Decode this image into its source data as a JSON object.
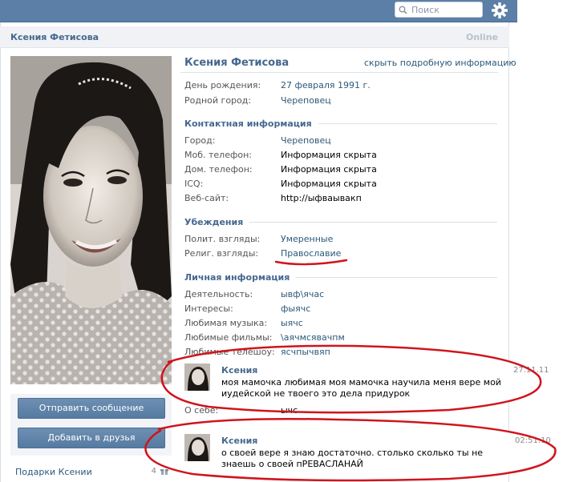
{
  "header": {
    "search_placeholder": "Поиск",
    "bar_color": "#5b7fa6"
  },
  "page": {
    "title": "Ксения Фетисова",
    "status": "Online"
  },
  "buttons": {
    "send_message": "Отправить сообщение",
    "add_friend": "Добавить в друзья"
  },
  "gifts": {
    "label": "Подарки Ксении",
    "count": "4"
  },
  "profile": {
    "name": "Ксения Фетисова",
    "hide_link": "скрыть подробную информацию",
    "basic": [
      {
        "label": "День рождения:",
        "value": "27 февраля 1991 г."
      },
      {
        "label": "Родной город:",
        "value": "Череповец"
      }
    ],
    "contacts": {
      "heading": "Контактная информация",
      "rows": [
        {
          "label": "Город:",
          "value": "Череповец"
        },
        {
          "label": "Моб. телефон:",
          "value": "Информация скрыта"
        },
        {
          "label": "Дом. телефон:",
          "value": "Информация скрыта"
        },
        {
          "label": "ICQ:",
          "value": "Информация скрыта"
        },
        {
          "label": "Веб-сайт:",
          "value": "http://ыфваывакп"
        }
      ]
    },
    "beliefs": {
      "heading": "Убеждения",
      "rows": [
        {
          "label": "Полит. взгляды:",
          "value": "Умеренные"
        },
        {
          "label": "Религ. взгляды:",
          "value": "Православие"
        }
      ]
    },
    "personal": {
      "heading": "Личная информация",
      "rows": [
        {
          "label": "Деятельность:",
          "value": "ывф\\ячас"
        },
        {
          "label": "Интересы:",
          "value": "фыячс"
        },
        {
          "label": "Любимая музыка:",
          "value": "ыячс"
        },
        {
          "label": "Любимые фильмы:",
          "value": "\\аячмсявачпм"
        },
        {
          "label": "Любимые телешоу:",
          "value": "ясчпычвяп"
        },
        {
          "label": "О себе:",
          "value": "ычс"
        }
      ]
    }
  },
  "comments": [
    {
      "author": "Ксения",
      "text": "моя мамочка любимая моя мамочка научила меня вере мой иудейской не твоего это дела придурок",
      "time": "27.11.11"
    },
    {
      "author": "Ксения",
      "text": "о своей вере я знаю достаточно. столько сколько ты не знаешь о своей пРЕВАСЛАНАЙ",
      "time": "02:51:10"
    }
  ],
  "annotation_color": "#d0141c"
}
